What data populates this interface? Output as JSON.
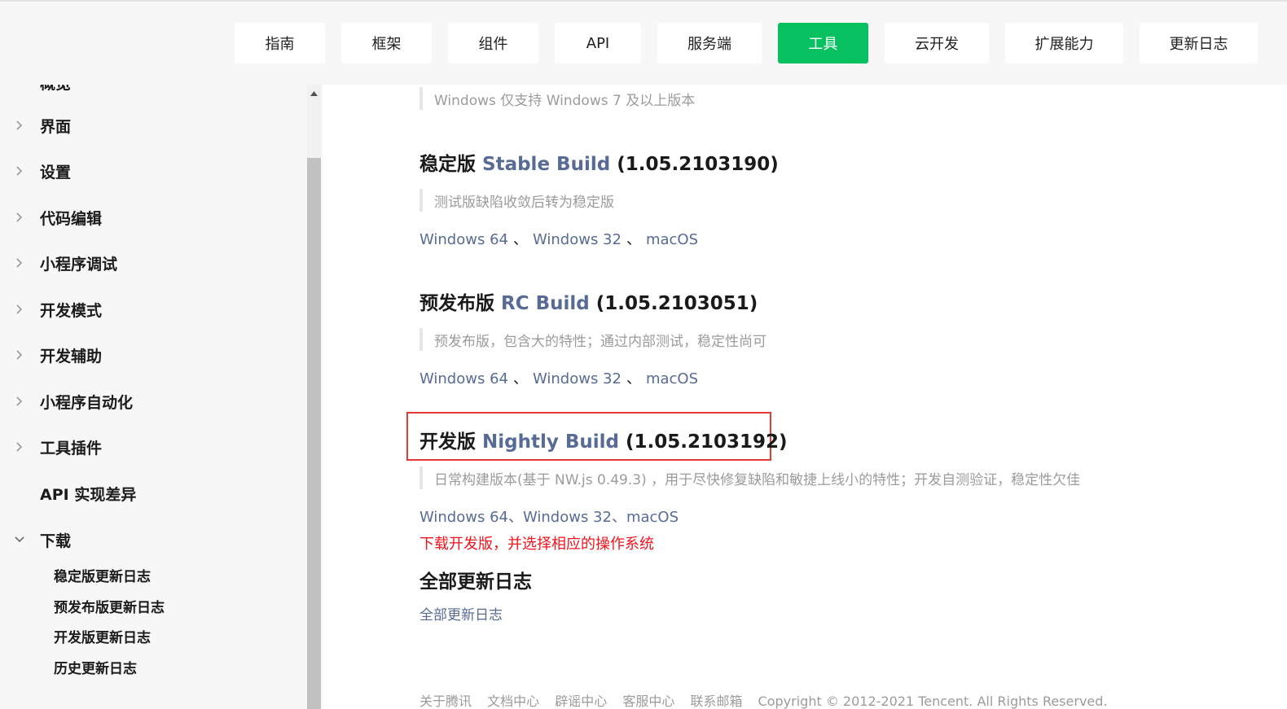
{
  "nav": {
    "tabs": [
      {
        "label": "指南"
      },
      {
        "label": "框架"
      },
      {
        "label": "组件"
      },
      {
        "label": "API"
      },
      {
        "label": "服务端"
      },
      {
        "label": "工具"
      },
      {
        "label": "云开发"
      },
      {
        "label": "扩展能力"
      },
      {
        "label": "更新日志"
      }
    ],
    "active_index": 5
  },
  "sidebar": {
    "cut_item": "概览",
    "items": [
      {
        "label": "界面"
      },
      {
        "label": "设置"
      },
      {
        "label": "代码编辑"
      },
      {
        "label": "小程序调试"
      },
      {
        "label": "开发模式"
      },
      {
        "label": "开发辅助"
      },
      {
        "label": "小程序自动化"
      },
      {
        "label": "工具插件"
      },
      {
        "label": "API 实现差异"
      },
      {
        "label": "下载"
      }
    ],
    "sub_items": [
      {
        "label": "稳定版更新日志"
      },
      {
        "label": "预发布版更新日志"
      },
      {
        "label": "开发版更新日志"
      },
      {
        "label": "历史更新日志"
      }
    ]
  },
  "content": {
    "top_note": "Windows 仅支持 Windows 7 及以上版本",
    "stable": {
      "prefix": "稳定版",
      "build": "Stable Build",
      "version": "(1.05.2103190)",
      "note": "测试版缺陷收敛后转为稳定版",
      "links": [
        "Windows 64",
        "Windows 32",
        "macOS"
      ]
    },
    "rc": {
      "prefix": "预发布版",
      "build": "RC Build",
      "version": "(1.05.2103051)",
      "note": "预发布版，包含大的特性；通过内部测试，稳定性尚可",
      "links": [
        "Windows 64",
        "Windows 32",
        "macOS"
      ]
    },
    "nightly": {
      "prefix": "开发版",
      "build": "Nightly Build",
      "version": "(1.05.2103192)",
      "note": "日常构建版本(基于 NW.js 0.49.3) ，用于尽快修复缺陷和敏捷上线小的特性；开发自测验证，稳定性欠佳",
      "links_text": "Windows 64、Windows 32、macOS",
      "annotation": "下载开发版，并选择相应的操作系统"
    },
    "all_changelog": {
      "heading": "全部更新日志",
      "link": "全部更新日志"
    },
    "footer": [
      "关于腾讯",
      "文档中心",
      "辟谣中心",
      "客服中心",
      "联系邮箱",
      "Copyright © 2012-2021 Tencent. All Rights Reserved."
    ],
    "sep": "、"
  },
  "colors": {
    "accent": "#07c160",
    "link": "#576b95",
    "annotation_red": "#f0141e"
  }
}
